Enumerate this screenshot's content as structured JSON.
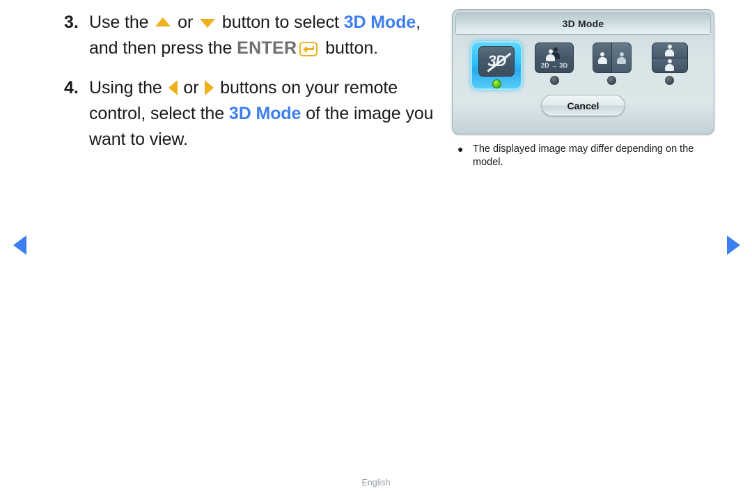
{
  "page": {
    "footer_language": "English",
    "accent_blue": "#3d7ef0",
    "accent_gold": "#efb01e"
  },
  "instructions": [
    {
      "number": "3.",
      "seg1": "Use the ",
      "icon_up": "triangle-up-icon",
      "seg2": " or ",
      "icon_down": "triangle-down-icon",
      "seg3": " button to select ",
      "highlight": "3D Mode",
      "seg4": ", and then press the ",
      "enter_word": "ENTER",
      "enter_icon": "enter-key-icon",
      "seg5": " button."
    },
    {
      "number": "4.",
      "seg1": "Using the ",
      "icon_left": "triangle-left-icon",
      "seg2": " or ",
      "icon_right": "triangle-right-icon",
      "seg3": " buttons on your remote control, select the ",
      "highlight": "3D Mode",
      "seg4": " of the image you want to view."
    }
  ],
  "dialog": {
    "title": "3D Mode",
    "cancel_label": "Cancel",
    "modes": [
      {
        "name": "3d-off",
        "glyph": "3D",
        "label": "",
        "selected": true,
        "led": "on"
      },
      {
        "name": "2d-to-3d",
        "glyph": "",
        "label": "2D → 3D",
        "selected": false,
        "led": "off"
      },
      {
        "name": "side-by-side",
        "glyph": "",
        "label": "",
        "selected": false,
        "led": "off"
      },
      {
        "name": "top-and-bottom",
        "glyph": "",
        "label": "",
        "selected": false,
        "led": "off"
      }
    ]
  },
  "caption": {
    "bullet": "●",
    "text": "The displayed image may differ depending on the model."
  },
  "nav": {
    "prev": "previous-page-arrow",
    "next": "next-page-arrow"
  }
}
